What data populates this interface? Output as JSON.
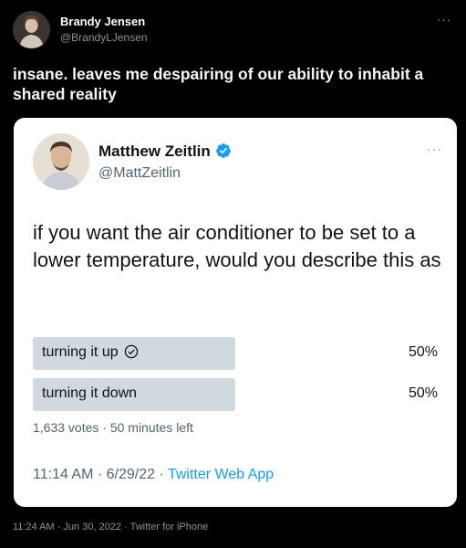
{
  "outer_tweet": {
    "author_name": "Brandy Jensen",
    "author_handle": "@BrandyLJensen",
    "more_icon": "···",
    "text": "insane. leaves me despairing of our ability to inhabit a shared reality",
    "footer": "11:24 AM · Jun 30, 2022 · Twitter for iPhone"
  },
  "quoted_tweet": {
    "author_name": "Matthew Zeitlin",
    "author_handle": "@MattZeitlin",
    "verified_color": "#1d9bf0",
    "more_icon": "···",
    "text": "if you want the air conditioner to be set to a lower temperature, would you describe this as",
    "poll": {
      "options": [
        {
          "label": "turning it up",
          "percent": "50%",
          "fill": 0.5,
          "checked": true
        },
        {
          "label": "turning it down",
          "percent": "50%",
          "fill": 0.5,
          "checked": false
        }
      ],
      "meta": "1,633 votes · 50 minutes left",
      "bar_color": "#cfd9de"
    },
    "timestamp": "11:14 AM · 6/29/22 · ",
    "app": "Twitter Web App"
  }
}
